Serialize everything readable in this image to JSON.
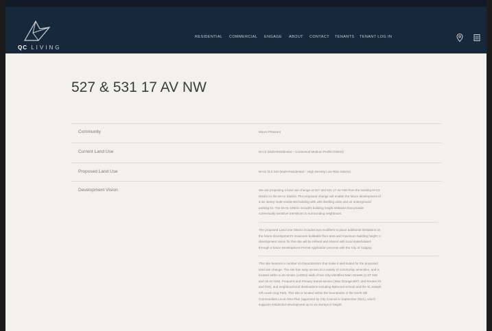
{
  "header": {
    "brand": {
      "mark": "QC",
      "name": "LIVING"
    },
    "nav": [
      "RESIDENTIAL",
      "COMMERCIAL",
      "ENGAGE",
      "ABOUT",
      "CONTACT",
      "TENANTS",
      "TENANT LOG IN"
    ],
    "icons": [
      "map-pin-icon",
      "menu-icon"
    ]
  },
  "page": {
    "title": "527 & 531 17 AV NW"
  },
  "details": [
    {
      "label": "Community",
      "value": "Mount Pleasant"
    },
    {
      "label": "Current Land Use",
      "value": "M-C2 (Multi-Residential – Contextual Medium Profile District)"
    },
    {
      "label": "Proposed Land Use",
      "value": "M-H1 f4.0 h20 (Multi-Residential – High Density Low Rise District)"
    },
    {
      "label": "Development Vision"
    }
  ],
  "vision_paragraphs": [
    [
      "We are proposing a land use change at 527 and 531 17 AV NW from the existing M-C2",
      "District to the M-H1 District. The proposed change will enable the future development of",
      "a six storey multi-residential building with ±60 dwelling units and an underground",
      "parking lot. The M-H1 District includes building height setbacks that provide",
      "contextually sensitive transitions to surrounding neighbours."
    ],
    [
      "The proposed Land Use District includes two modifiers to place additional limitations on",
      "the future development's maximum buildable floor area and maximum building height. A",
      "development vision for this site will be refined and shared with local stakeholders",
      "through a future Development Permit Application process with the City of Calgary."
    ],
    [
      "This site features a number of characteristics that make it well suited for the proposed",
      "land use change. The site has easy access to a variety of community amenities, and is",
      "located within a ±5 minute (±400m) walk of two City-identified Main Streets (4 ST NW",
      "and 16 AV NW). Frequent and Primary transit service (Max Orange BRT, and Routes #2",
      "and #19), and neighbourhood destinations including Balmoral School and the St Joseph",
      "Off Leash Dog Park. This site is located within the boundaries of the North Hill",
      "Communities Local Area Plan (approved by City Council in September 2021), which",
      "supports residential development up to six storeys in height."
    ]
  ],
  "colors": {
    "header": "#16283a",
    "background": "#f3f1ed",
    "text": "#8c8c8c",
    "rule": "#dedad3"
  }
}
